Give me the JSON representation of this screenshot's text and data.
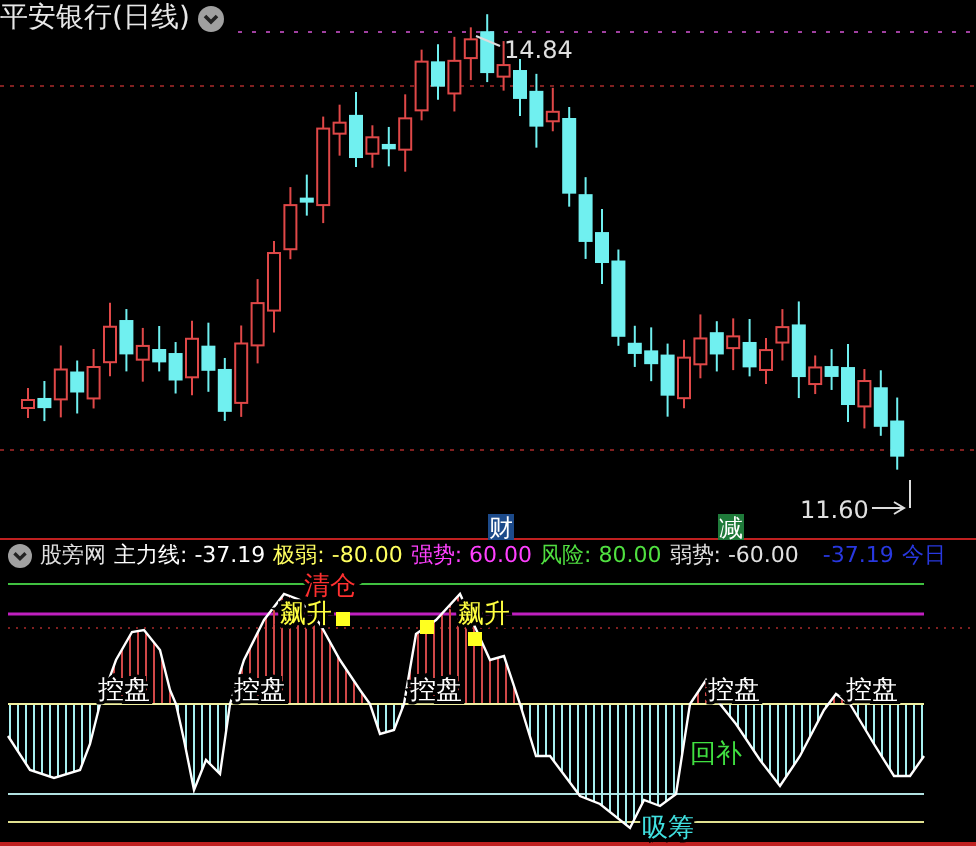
{
  "title": "平安银行(日线)",
  "price_chart": {
    "high_label": "14.84",
    "low_label": "11.60",
    "events": [
      {
        "text": "财",
        "color": "#1c4a8a"
      },
      {
        "text": "减",
        "color": "#1f7a3a"
      }
    ]
  },
  "legend": {
    "name": "股旁网",
    "items": [
      {
        "text": "主力线: -37.19",
        "color": "#ffffff"
      },
      {
        "text": "极弱: -80.00",
        "color": "#ffff60"
      },
      {
        "text": "强势: 60.00",
        "color": "#ff40ff"
      },
      {
        "text": "风险: 80.00",
        "color": "#50e040"
      },
      {
        "text": "弱势: -60.00",
        "color": "#e0e0e0"
      },
      {
        "text": "-37.19",
        "color": "#2838e0"
      },
      {
        "text": "今日",
        "color": "#2838e0"
      }
    ]
  },
  "signals": [
    {
      "text": "清仓",
      "color": "#ff3030"
    },
    {
      "text": "飙升",
      "color": "#ffff40"
    },
    {
      "text": "飙升",
      "color": "#ffff40"
    },
    {
      "text": "控盘",
      "color": "#ffffff"
    },
    {
      "text": "控盘",
      "color": "#ffffff"
    },
    {
      "text": "控盘",
      "color": "#ffffff"
    },
    {
      "text": "控盘",
      "color": "#ffffff"
    },
    {
      "text": "控盘",
      "color": "#ffffff"
    },
    {
      "text": "回补",
      "color": "#40e040"
    },
    {
      "text": "吸筹",
      "color": "#40e0e0"
    }
  ]
}
